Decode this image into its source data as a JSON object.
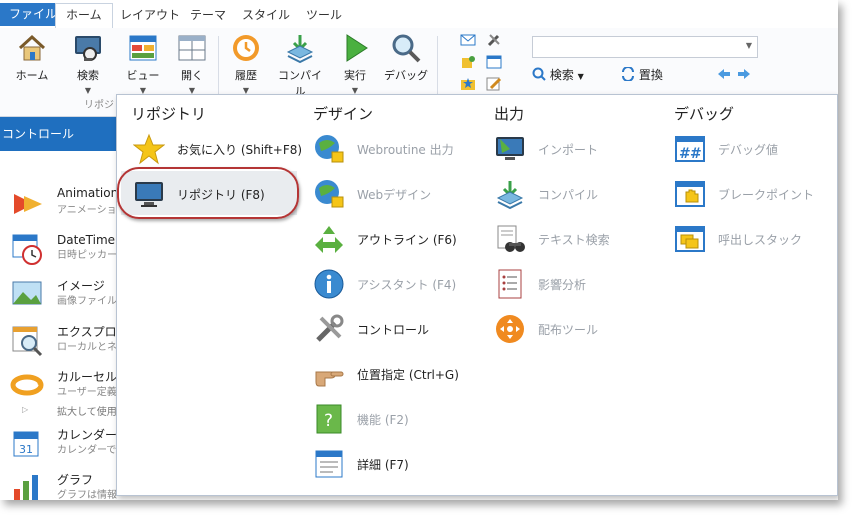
{
  "tabs": {
    "file": "ファイル",
    "home": "ホーム",
    "layout": "レイアウト",
    "theme": "テーマ",
    "style": "スタイル",
    "tool": "ツール"
  },
  "ribbon": {
    "home": "ホーム",
    "search": "検索",
    "view": "ビュー",
    "open": "開く",
    "history": "履歴",
    "compile": "コンパイル",
    "run": "実行",
    "debug": "デバッグ",
    "find": "検索",
    "replace": "置換",
    "group_repo": "リポジト"
  },
  "left_panel": {
    "header": "コントロール",
    "items": [
      {
        "title": "Animation",
        "sub": "アニメーション"
      },
      {
        "title": "DateTimeピ",
        "sub": "日時ピッカーで"
      },
      {
        "title": "イメージ",
        "sub": "画像ファイルを"
      },
      {
        "title": "エクスプローラ",
        "sub": "ローカルとネッ"
      },
      {
        "title": "カルーセル",
        "sub": "ユーザー定義の"
      },
      {
        "title": "カレンダー",
        "sub": "カレンダーでユ"
      },
      {
        "title": "グラフ",
        "sub": "グラフは情報"
      }
    ],
    "expand": "拡大して使用"
  },
  "dropdown": {
    "columns": [
      {
        "header": "リポジトリ",
        "items": [
          {
            "label": "お気に入り (Shift+F8)",
            "icon": "star-icon",
            "dim": false
          },
          {
            "label": "リポジトリ (F8)",
            "icon": "monitor-icon",
            "dim": false
          }
        ]
      },
      {
        "header": "デザイン",
        "items": [
          {
            "label": "Webroutine 出力",
            "icon": "globe-lock-icon",
            "dim": true
          },
          {
            "label": "Webデザイン",
            "icon": "globe-lock-icon",
            "dim": true
          },
          {
            "label": "アウトライン (F6)",
            "icon": "outline-arrows-icon",
            "dim": false
          },
          {
            "label": "アシスタント (F4)",
            "icon": "info-icon",
            "dim": true
          },
          {
            "label": "コントロール",
            "icon": "tools-icon",
            "dim": false
          },
          {
            "label": "位置指定 (Ctrl+G)",
            "icon": "pointing-hand-icon",
            "dim": false
          },
          {
            "label": "機能 (F2)",
            "icon": "help-book-icon",
            "dim": true
          },
          {
            "label": "詳細 (F7)",
            "icon": "details-icon",
            "dim": false
          }
        ]
      },
      {
        "header": "出力",
        "items": [
          {
            "label": "インポート",
            "icon": "import-icon",
            "dim": true
          },
          {
            "label": "コンパイル",
            "icon": "compile-icon",
            "dim": true
          },
          {
            "label": "テキスト検索",
            "icon": "binoculars-icon",
            "dim": true
          },
          {
            "label": "影響分析",
            "icon": "list-icon",
            "dim": true
          },
          {
            "label": "配布ツール",
            "icon": "deploy-icon",
            "dim": true
          }
        ]
      },
      {
        "header": "デバッグ",
        "items": [
          {
            "label": "デバッグ値",
            "icon": "hash-icon",
            "dim": true
          },
          {
            "label": "ブレークポイント",
            "icon": "breakpoint-hand-icon",
            "dim": true
          },
          {
            "label": "呼出しスタック",
            "icon": "stack-icon",
            "dim": true
          }
        ]
      }
    ]
  },
  "colors": {
    "accent": "#2b78c8",
    "header": "#1f6fbf",
    "highlight": "#b43535"
  }
}
